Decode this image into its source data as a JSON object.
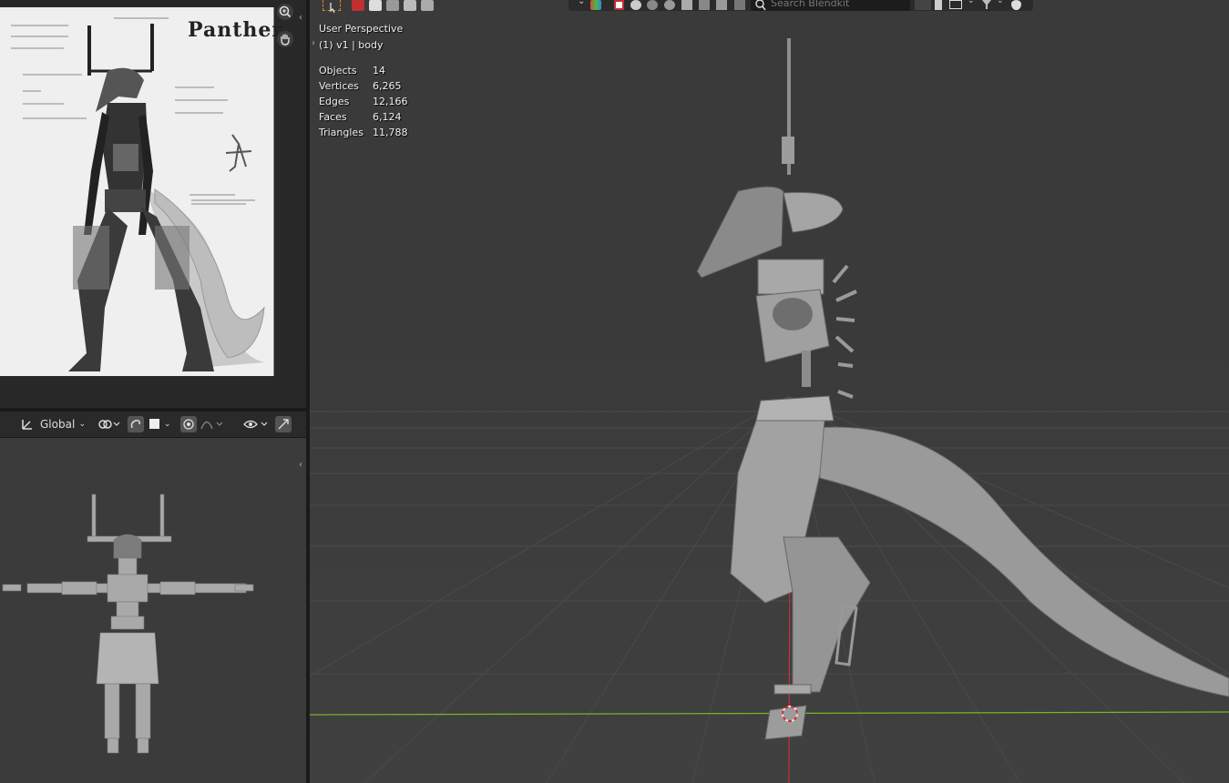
{
  "reference_image": {
    "title": "Panther"
  },
  "left_header": {
    "orientation_label": "Global"
  },
  "viewport": {
    "view_name": "User Perspective",
    "collection_info": "(1) v1 | body",
    "stats": [
      {
        "label": "Objects",
        "value": "14"
      },
      {
        "label": "Vertices",
        "value": "6,265"
      },
      {
        "label": "Edges",
        "value": "12,166"
      },
      {
        "label": "Faces",
        "value": "6,124"
      },
      {
        "label": "Triangles",
        "value": "11,788"
      }
    ]
  },
  "top_toolbar": {
    "search_placeholder": "Search Blendkit"
  },
  "colors": {
    "x_axis": "#c8303a",
    "y_axis": "#7ab42a",
    "grid": "#4a4a4a",
    "model": "#9a9a9a"
  }
}
